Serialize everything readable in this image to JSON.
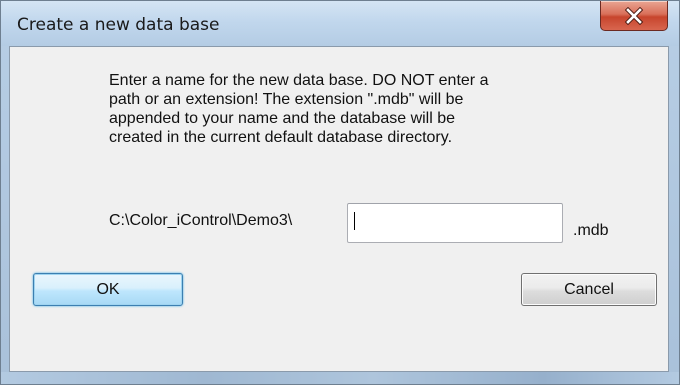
{
  "window": {
    "title": "Create a new data base"
  },
  "dialog": {
    "instructions": "Enter a name for the new data base. DO NOT enter a\npath or an extension! The extension \".mdb\" will be\nappended to your name and the database will be\ncreated in the current default database directory.",
    "path_prefix": "C:\\Color_iControl\\Demo3\\",
    "name_input_value": "",
    "extension": ".mdb"
  },
  "buttons": {
    "ok_label": "OK",
    "cancel_label": "Cancel"
  },
  "icons": {
    "close": "close-icon"
  },
  "colors": {
    "titlebar": "#c1d7ed",
    "client_bg": "#f0f0f0",
    "close_button": "#c7452d",
    "ok_button_border": "#3c7fb1"
  }
}
